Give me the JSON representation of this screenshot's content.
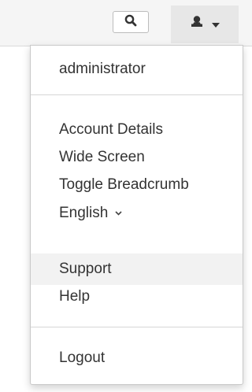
{
  "navbar": {
    "search_icon": "search-icon",
    "user_icon": "user-icon",
    "dropdown_icon": "caret-down-icon"
  },
  "user_menu": {
    "username": "administrator",
    "items": [
      {
        "label": "Account Details"
      },
      {
        "label": "Wide Screen"
      },
      {
        "label": "Toggle Breadcrumb"
      },
      {
        "label": "English"
      },
      {
        "label": "Support"
      },
      {
        "label": "Help"
      }
    ],
    "logout_label": "Logout"
  }
}
